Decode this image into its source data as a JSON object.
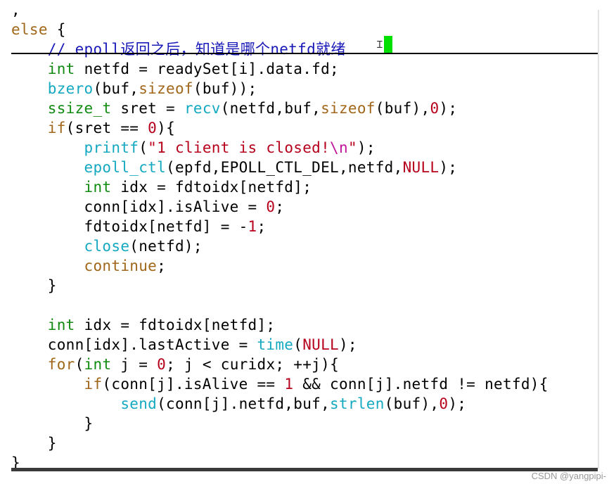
{
  "editor": {
    "cursor_line": 2,
    "lines": [
      {
        "tokens": [
          {
            "t": ",",
            "c": "plain"
          }
        ]
      },
      {
        "tokens": [
          {
            "t": "else",
            "c": "kw"
          },
          {
            "t": " {",
            "c": "plain"
          }
        ]
      },
      {
        "tokens": [
          {
            "t": "    // epoll返回之后，知道是哪个netfd就绪",
            "c": "comment"
          }
        ]
      },
      {
        "tokens": [
          {
            "t": "    ",
            "c": "plain"
          },
          {
            "t": "int",
            "c": "type"
          },
          {
            "t": " netfd = readySet[i].data.fd;",
            "c": "plain"
          }
        ]
      },
      {
        "tokens": [
          {
            "t": "    ",
            "c": "plain"
          },
          {
            "t": "bzero",
            "c": "fn"
          },
          {
            "t": "(buf,",
            "c": "plain"
          },
          {
            "t": "sizeof",
            "c": "kw"
          },
          {
            "t": "(buf));",
            "c": "plain"
          }
        ]
      },
      {
        "tokens": [
          {
            "t": "    ",
            "c": "plain"
          },
          {
            "t": "ssize_t",
            "c": "type"
          },
          {
            "t": " sret = ",
            "c": "plain"
          },
          {
            "t": "recv",
            "c": "fn"
          },
          {
            "t": "(netfd,buf,",
            "c": "plain"
          },
          {
            "t": "sizeof",
            "c": "kw"
          },
          {
            "t": "(buf),",
            "c": "plain"
          },
          {
            "t": "0",
            "c": "num"
          },
          {
            "t": ");",
            "c": "plain"
          }
        ]
      },
      {
        "tokens": [
          {
            "t": "    ",
            "c": "plain"
          },
          {
            "t": "if",
            "c": "kw"
          },
          {
            "t": "(sret == ",
            "c": "plain"
          },
          {
            "t": "0",
            "c": "num"
          },
          {
            "t": "){",
            "c": "plain"
          }
        ]
      },
      {
        "tokens": [
          {
            "t": "        ",
            "c": "plain"
          },
          {
            "t": "printf",
            "c": "fn"
          },
          {
            "t": "(",
            "c": "plain"
          },
          {
            "t": "\"1 client is closed!",
            "c": "str"
          },
          {
            "t": "\\n",
            "c": "esc"
          },
          {
            "t": "\"",
            "c": "str"
          },
          {
            "t": ");",
            "c": "plain"
          }
        ]
      },
      {
        "tokens": [
          {
            "t": "        ",
            "c": "plain"
          },
          {
            "t": "epoll_ctl",
            "c": "fn"
          },
          {
            "t": "(epfd,EPOLL_CTL_DEL,netfd,",
            "c": "plain"
          },
          {
            "t": "NULL",
            "c": "str"
          },
          {
            "t": ");",
            "c": "plain"
          }
        ]
      },
      {
        "tokens": [
          {
            "t": "        ",
            "c": "plain"
          },
          {
            "t": "int",
            "c": "type"
          },
          {
            "t": " idx = fdtoidx[netfd];",
            "c": "plain"
          }
        ]
      },
      {
        "tokens": [
          {
            "t": "        conn[idx].isAlive = ",
            "c": "plain"
          },
          {
            "t": "0",
            "c": "num"
          },
          {
            "t": ";",
            "c": "plain"
          }
        ]
      },
      {
        "tokens": [
          {
            "t": "        fdtoidx[netfd] = -",
            "c": "plain"
          },
          {
            "t": "1",
            "c": "num"
          },
          {
            "t": ";",
            "c": "plain"
          }
        ]
      },
      {
        "tokens": [
          {
            "t": "        ",
            "c": "plain"
          },
          {
            "t": "close",
            "c": "fn"
          },
          {
            "t": "(netfd);",
            "c": "plain"
          }
        ]
      },
      {
        "tokens": [
          {
            "t": "        ",
            "c": "plain"
          },
          {
            "t": "continue",
            "c": "kw"
          },
          {
            "t": ";",
            "c": "plain"
          }
        ]
      },
      {
        "tokens": [
          {
            "t": "    }",
            "c": "plain"
          }
        ]
      },
      {
        "tokens": [
          {
            "t": "",
            "c": "plain"
          }
        ]
      },
      {
        "tokens": [
          {
            "t": "    ",
            "c": "plain"
          },
          {
            "t": "int",
            "c": "type"
          },
          {
            "t": " idx = fdtoidx[netfd];",
            "c": "plain"
          }
        ]
      },
      {
        "tokens": [
          {
            "t": "    conn[idx].lastActive = ",
            "c": "plain"
          },
          {
            "t": "time",
            "c": "fn"
          },
          {
            "t": "(",
            "c": "plain"
          },
          {
            "t": "NULL",
            "c": "str"
          },
          {
            "t": ");",
            "c": "plain"
          }
        ]
      },
      {
        "tokens": [
          {
            "t": "    ",
            "c": "plain"
          },
          {
            "t": "for",
            "c": "kw"
          },
          {
            "t": "(",
            "c": "plain"
          },
          {
            "t": "int",
            "c": "type"
          },
          {
            "t": " j = ",
            "c": "plain"
          },
          {
            "t": "0",
            "c": "num"
          },
          {
            "t": "; j < curidx; ++j){",
            "c": "plain"
          }
        ]
      },
      {
        "tokens": [
          {
            "t": "        ",
            "c": "plain"
          },
          {
            "t": "if",
            "c": "kw"
          },
          {
            "t": "(conn[j].isAlive == ",
            "c": "plain"
          },
          {
            "t": "1",
            "c": "num"
          },
          {
            "t": " && conn[j].netfd != netfd){",
            "c": "plain"
          }
        ]
      },
      {
        "tokens": [
          {
            "t": "            ",
            "c": "plain"
          },
          {
            "t": "send",
            "c": "fn"
          },
          {
            "t": "(conn[j].netfd,buf,",
            "c": "plain"
          },
          {
            "t": "strlen",
            "c": "fn"
          },
          {
            "t": "(buf),",
            "c": "plain"
          },
          {
            "t": "0",
            "c": "num"
          },
          {
            "t": ");",
            "c": "plain"
          }
        ]
      },
      {
        "tokens": [
          {
            "t": "        }",
            "c": "plain"
          }
        ]
      },
      {
        "tokens": [
          {
            "t": "    }",
            "c": "plain"
          }
        ]
      },
      {
        "tokens": [
          {
            "t": "}",
            "c": "plain"
          }
        ]
      }
    ]
  },
  "colors": {
    "keyword": "#a0661a",
    "type": "#118a11",
    "function": "#14a9c0",
    "string": "#b6001c",
    "escape": "#c0149b",
    "number": "#b6001c",
    "comment": "#1a1ab8",
    "cursor": "#00e000"
  },
  "watermark": {
    "text": "CSDN @yangpipi-"
  }
}
